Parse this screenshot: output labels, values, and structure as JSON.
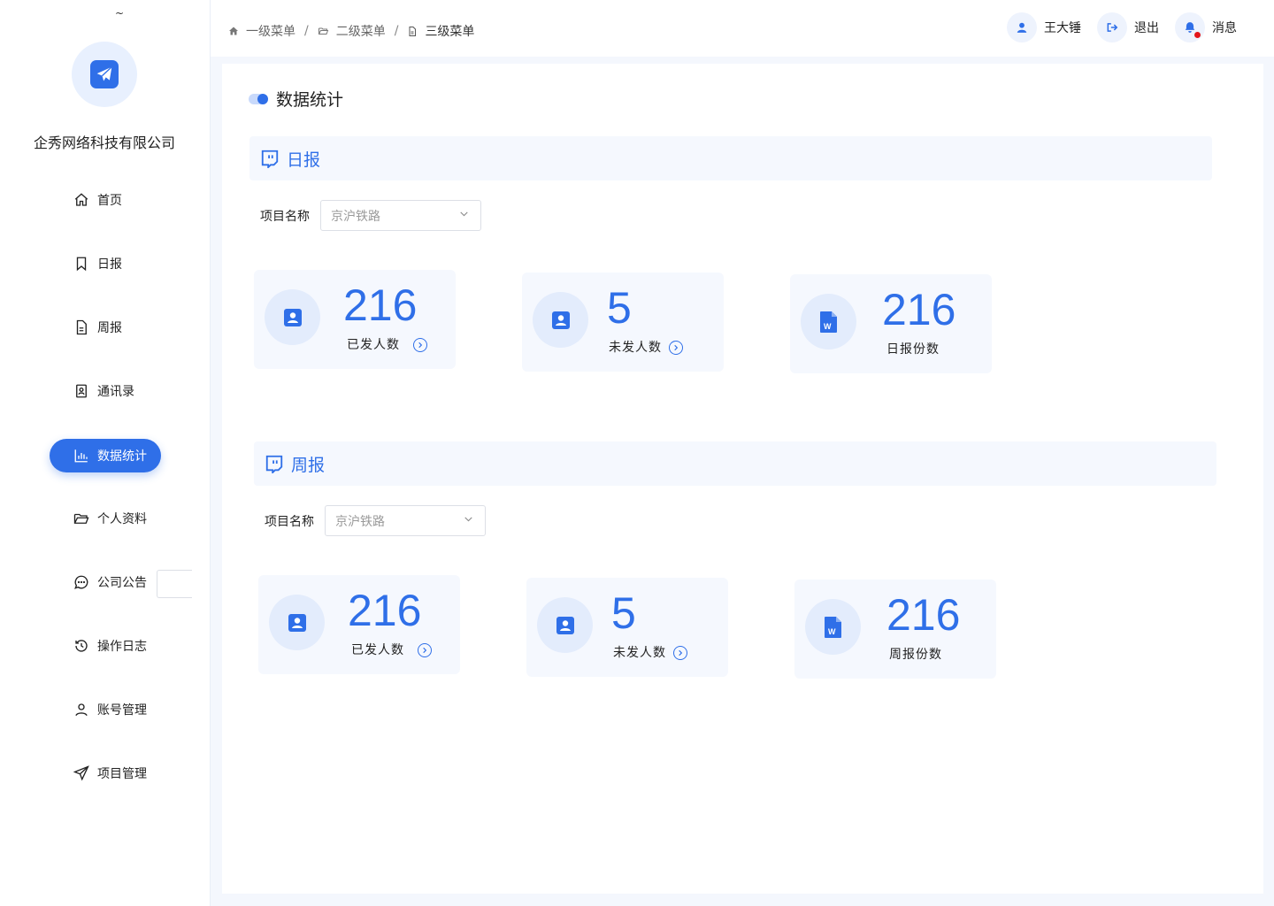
{
  "sidebar": {
    "tilde": "~",
    "company": "企秀网络科技有限公司",
    "items": [
      {
        "label": "首页",
        "icon": "home-icon"
      },
      {
        "label": "日报",
        "icon": "bookmark-icon"
      },
      {
        "label": "周报",
        "icon": "file-text-icon"
      },
      {
        "label": "通讯录",
        "icon": "contacts-icon"
      },
      {
        "label": "数据统计",
        "icon": "bar-chart-icon",
        "active": true
      },
      {
        "label": "个人资料",
        "icon": "folder-open-icon"
      },
      {
        "label": "公司公告",
        "icon": "message-circle-icon"
      },
      {
        "label": "操作日志",
        "icon": "history-icon"
      },
      {
        "label": "账号管理",
        "icon": "user-icon"
      },
      {
        "label": "项目管理",
        "icon": "send-icon"
      }
    ]
  },
  "breadcrumb": [
    "一级菜单",
    "二级菜单",
    "三级菜单"
  ],
  "breadcrumb_sep": "/",
  "user": {
    "name": "王大锤",
    "logout": "退出",
    "messages": "消息"
  },
  "page_title": "数据统计",
  "daily": {
    "title": "日报",
    "filter_label": "项目名称",
    "filter_value": "京沪铁路",
    "cards": [
      {
        "value": "216",
        "label": "已发人数",
        "icon": "contact-card-icon"
      },
      {
        "value": "5",
        "label": "未发人数",
        "icon": "contact-card-icon"
      },
      {
        "value": "216",
        "label": "日报份数",
        "icon": "word-doc-icon"
      }
    ]
  },
  "weekly": {
    "title": "周报",
    "filter_label": "项目名称",
    "filter_value": "京沪铁路",
    "cards": [
      {
        "value": "216",
        "label": "已发人数",
        "icon": "contact-card-icon"
      },
      {
        "value": "5",
        "label": "未发人数",
        "icon": "contact-card-icon"
      },
      {
        "value": "216",
        "label": "周报份数",
        "icon": "word-doc-icon"
      }
    ]
  },
  "colors": {
    "accent": "#2f6fe8",
    "alert": "#e4161b"
  }
}
